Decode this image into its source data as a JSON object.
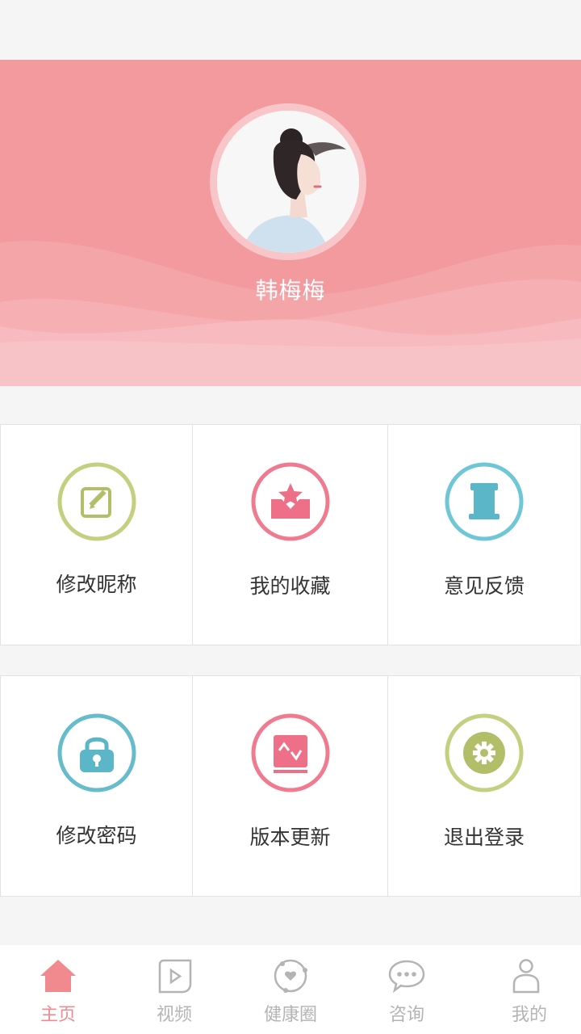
{
  "profile": {
    "username": "韩梅梅"
  },
  "menu": {
    "row1": [
      {
        "label": "修改昵称",
        "icon": "edit-icon",
        "color": "#c4cf7f"
      },
      {
        "label": "我的收藏",
        "icon": "star-inbox-icon",
        "color": "#f07a8f"
      },
      {
        "label": "意见反馈",
        "icon": "scroll-icon",
        "color": "#6ec6d6"
      }
    ],
    "row2": [
      {
        "label": "修改密码",
        "icon": "lock-icon",
        "color": "#66bccb"
      },
      {
        "label": "版本更新",
        "icon": "update-icon",
        "color": "#f07a8f"
      },
      {
        "label": "退出登录",
        "icon": "gear-icon",
        "color": "#c4cf7f"
      }
    ]
  },
  "tabbar": {
    "items": [
      {
        "label": "主页",
        "icon": "home-icon",
        "active": true
      },
      {
        "label": "视频",
        "icon": "video-icon",
        "active": false
      },
      {
        "label": "健康圈",
        "icon": "health-circle-icon",
        "active": false
      },
      {
        "label": "咨询",
        "icon": "chat-icon",
        "active": false
      },
      {
        "label": "我的",
        "icon": "user-icon",
        "active": false
      }
    ]
  },
  "colors": {
    "banner": "#f29a9e",
    "accent": "#f08a8f",
    "inactive": "#b4b4b4"
  }
}
